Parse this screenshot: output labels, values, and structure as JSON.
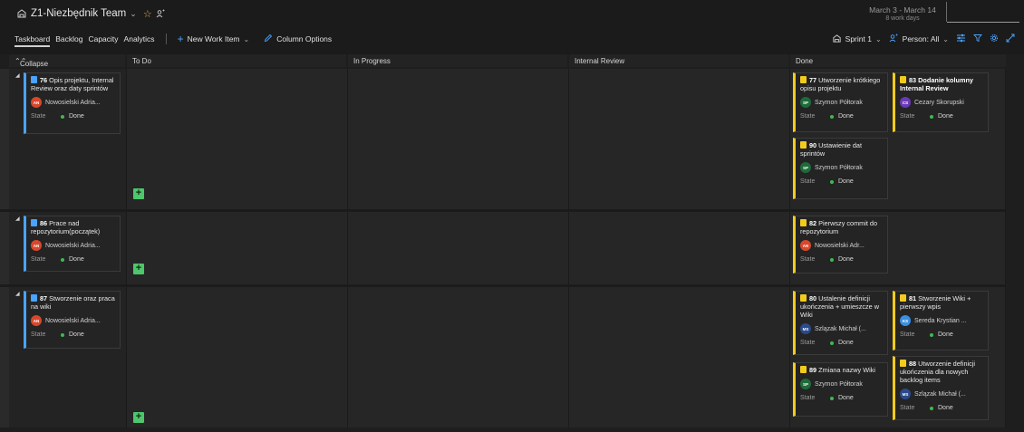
{
  "header": {
    "team_name": "Z1-Niezbędnik Team",
    "sprint_range": "March 3 - March 14",
    "work_days": "8 work days"
  },
  "tabs": [
    {
      "label": "Taskboard"
    },
    {
      "label": "Backlog"
    },
    {
      "label": "Capacity"
    },
    {
      "label": "Analytics"
    }
  ],
  "commands": {
    "new_work_item": "New Work Item",
    "column_options": "Column Options"
  },
  "toolbar": {
    "sprint": "Sprint 1",
    "person_filter": "Person: All"
  },
  "board": {
    "collapse_all": "Collapse all",
    "columns": [
      "To Do",
      "In Progress",
      "Internal Review",
      "Done"
    ],
    "state_label": "State",
    "lanes": [
      {
        "parent": {
          "id": "76",
          "title": "Opis projektu, Internal Review oraz daty sprintów",
          "assignee": "Nowosielski Adria...",
          "initials": "AN",
          "state": "Done"
        },
        "done": [
          {
            "id": "77",
            "title": "Utworzenie krótkiego opisu projektu",
            "assignee": "Szymon Półtorak",
            "initials": "SP",
            "state": "Done"
          },
          {
            "id": "83",
            "title": "Dodanie kolumny Internal Review",
            "assignee": "Cezary Skorupski",
            "initials": "CS",
            "state": "Done"
          },
          {
            "id": "90",
            "title": "Ustawienie dat sprintów",
            "assignee": "Szymon Półtorak",
            "initials": "SP",
            "state": "Done"
          }
        ]
      },
      {
        "parent": {
          "id": "86",
          "title": "Prace nad repozytorium(początek)",
          "assignee": "Nowosielski Adria...",
          "initials": "AN",
          "state": "Done"
        },
        "done": [
          {
            "id": "82",
            "title": "Pierwszy commit do repozytorium",
            "assignee": "Nowosielski Adr...",
            "initials": "AN",
            "state": "Done"
          }
        ]
      },
      {
        "parent": {
          "id": "87",
          "title": "Stworzenie oraz praca na wiki",
          "assignee": "Nowosielski Adria...",
          "initials": "AN",
          "state": "Done"
        },
        "done": [
          {
            "id": "80",
            "title": "Ustalenie definicji ukończenia + umieszcze w Wiki",
            "assignee": "Szlązak Michał (...",
            "initials": "MS",
            "state": "Done"
          },
          {
            "id": "81",
            "title": "Stworzenie Wiki + pierwszy wpis",
            "assignee": "Sereda Krystian ...",
            "initials": "KS",
            "state": "Done"
          },
          {
            "id": "89",
            "title": "Zmiana nazwy Wiki",
            "assignee": "Szymon Półtorak",
            "initials": "SP",
            "state": "Done"
          },
          {
            "id": "88",
            "title": "Utworzenie definicji ukończenia dla nowych backlog items",
            "assignee": "Szlązak Michał (...",
            "initials": "MS",
            "state": "Done"
          }
        ]
      }
    ]
  },
  "colors": {
    "pbi": "#4aa3ff",
    "task": "#f2cb1d",
    "done_dot": "#3fb950",
    "avatar_an": "#d9472b",
    "avatar_sp": "#1e6b3a",
    "avatar_cs": "#6a3bb5",
    "avatar_ks": "#3b8fe0",
    "avatar_ms": "#2b4a8a"
  }
}
